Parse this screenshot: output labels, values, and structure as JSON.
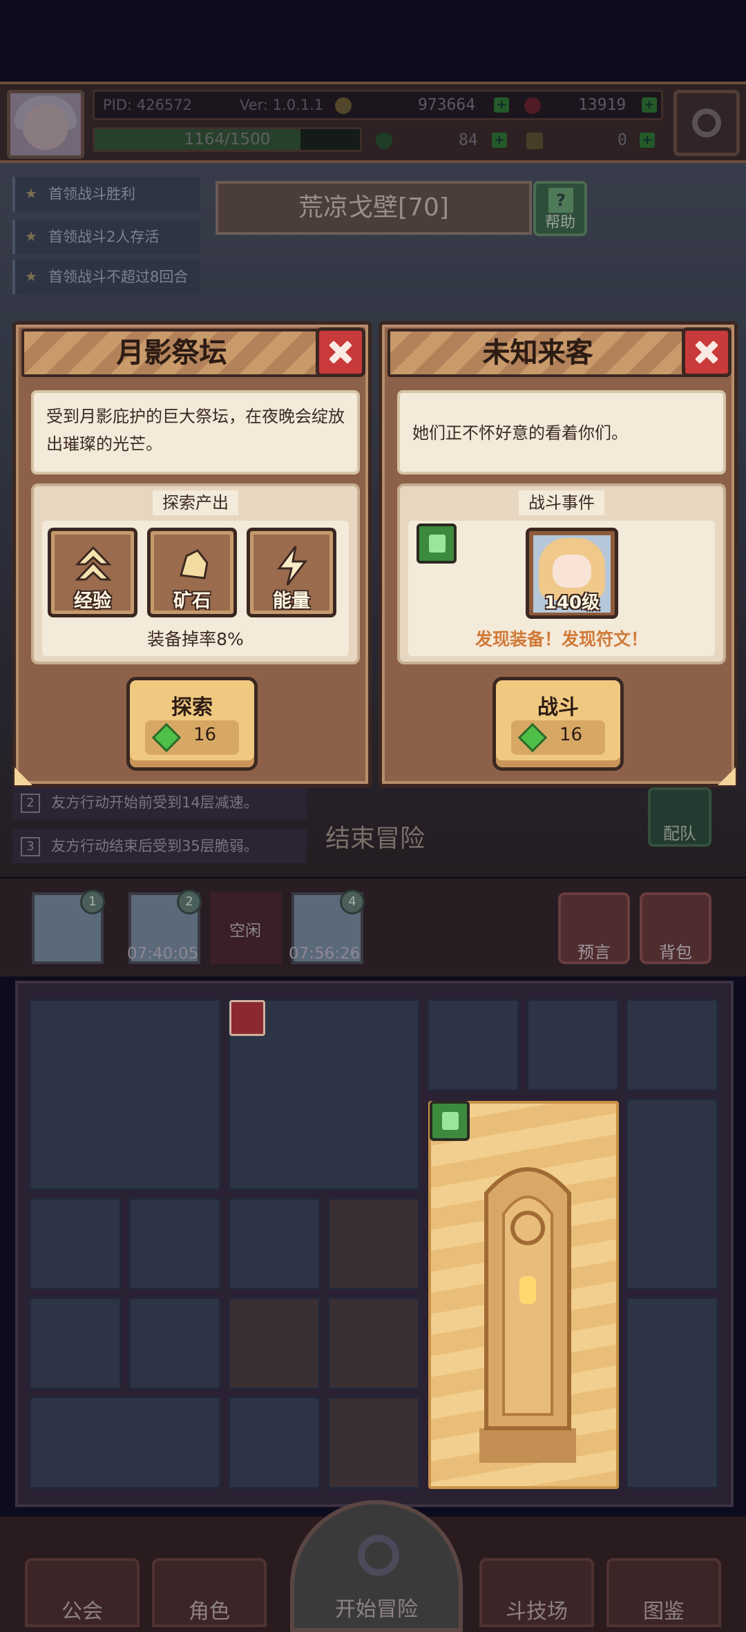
{
  "header": {
    "pid": "PID: 426572",
    "version": "Ver: 1.0.1.1",
    "gold": "973664",
    "red_gems": "13919",
    "xp": "1164/1500",
    "xp_fraction": 0.776,
    "clover": "84",
    "keys": "0"
  },
  "quests": [
    "首领战斗胜利",
    "首领战斗2人存活",
    "首领战斗不超过8回合"
  ],
  "zone": {
    "name": "荒凉戈壁[70]",
    "help_label": "帮助"
  },
  "left_panel": {
    "title": "月影祭坛",
    "description": "受到月影庇护的巨大祭坛，在夜晚会绽放出璀璨的光芒。",
    "section_title": "探索产出",
    "outputs": [
      "经验",
      "矿石",
      "能量"
    ],
    "drop_rate": "装备掉率8%",
    "action_label": "探索",
    "cost": "16"
  },
  "right_panel": {
    "title": "未知来客",
    "description": "她们正不怀好意的看着你们。",
    "section_title": "战斗事件",
    "enemy_level": "140级",
    "discovery": "发现装备！发现符文！",
    "action_label": "战斗",
    "cost": "16"
  },
  "buffs": [
    {
      "num": "2",
      "text": "友方行动开始前受到14层减速。"
    },
    {
      "num": "3",
      "text": "友方行动结束后受到35层脆弱。"
    }
  ],
  "end_adventure": "结束冒险",
  "team": "配队",
  "slots": [
    {
      "badge": "1",
      "time": ""
    },
    {
      "badge": "2",
      "time": "07:40:05"
    },
    {
      "badge": "",
      "time": "空闲"
    },
    {
      "badge": "4",
      "time": "07:56:26"
    }
  ],
  "right_buttons": [
    "预言",
    "背包"
  ],
  "nav": [
    "公会",
    "角色",
    "开始冒险",
    "斗技场",
    "图鉴"
  ]
}
